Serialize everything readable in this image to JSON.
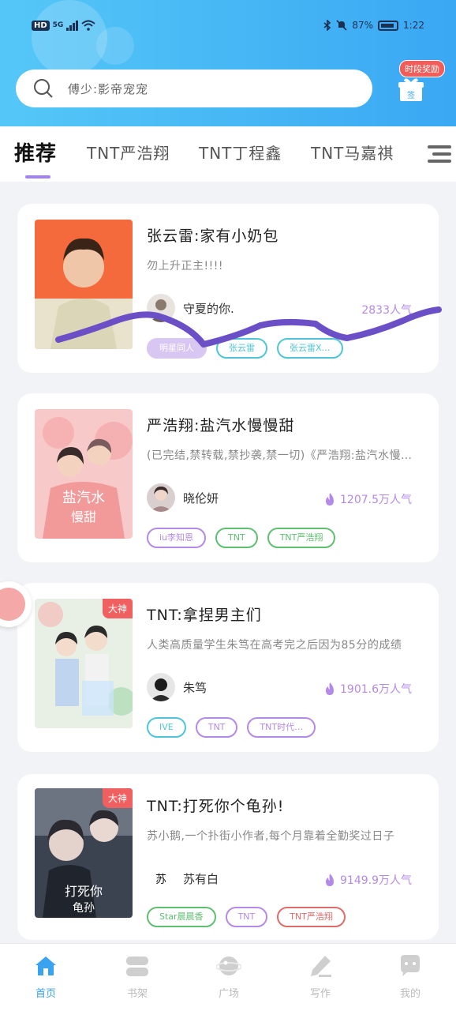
{
  "status_bar": {
    "hd": "HD",
    "signal": "5G",
    "battery": "87%",
    "time": "1:22"
  },
  "search": {
    "placeholder": "傅少:影帝宠宠"
  },
  "gift": {
    "badge": "时段奖励",
    "box_label": "签"
  },
  "tabs": [
    {
      "label": "推荐"
    },
    {
      "label": "TNT严浩翔"
    },
    {
      "label": "TNT丁程鑫"
    },
    {
      "label": "TNT马嘉祺"
    }
  ],
  "cards": [
    {
      "title": "张云雷:家有小奶包",
      "desc": "勿上升正主!!!!",
      "author": "守夏的你.",
      "popularity": "2833人气",
      "cover_tag": "",
      "tags": [
        {
          "label": "明星同人",
          "color": "#b48ae8"
        },
        {
          "label": "张云雷",
          "color": "#4ec6d8"
        },
        {
          "label": "张云雷X…",
          "color": "#4ec6d8"
        }
      ]
    },
    {
      "title": "严浩翔:盐汽水慢慢甜",
      "desc": "(已完结,禁转载,禁抄袭,禁一切)《严浩翔:盐汽水慢慢甜》",
      "author": "晓伦妍",
      "popularity": "1207.5万人气",
      "cover_tag": "",
      "tags": [
        {
          "label": "iu李知恩",
          "color": "#b48ae8"
        },
        {
          "label": "TNT",
          "color": "#5fbf70"
        },
        {
          "label": "TNT严浩翔",
          "color": "#5fbf70"
        }
      ]
    },
    {
      "title": "TNT:拿捏男主们",
      "desc": "人类高质量学生朱笃在高考完之后因为85分的成绩",
      "author": "朱笃",
      "popularity": "1901.6万人气",
      "cover_tag": "大神",
      "tags": [
        {
          "label": "IVE",
          "color": "#4ec6d8"
        },
        {
          "label": "TNT",
          "color": "#b48ae8"
        },
        {
          "label": "TNT时代…",
          "color": "#b48ae8"
        }
      ]
    },
    {
      "title": "TNT:打死你个龟孙!",
      "desc": "苏小鹅,一个扑街小作者,每个月靠着全勤奖过日子",
      "author": "苏有白",
      "popularity": "9149.9万人气",
      "cover_tag": "大神",
      "tags": [
        {
          "label": "Star晨晨香",
          "color": "#5fbf70"
        },
        {
          "label": "TNT",
          "color": "#b48ae8"
        },
        {
          "label": "TNT严浩翔",
          "color": "#e06b6b"
        }
      ]
    }
  ],
  "bottom_nav": [
    {
      "label": "首页",
      "icon": "home-icon",
      "active": true
    },
    {
      "label": "书架",
      "icon": "bookshelf-icon",
      "active": false
    },
    {
      "label": "广场",
      "icon": "planet-icon",
      "active": false
    },
    {
      "label": "写作",
      "icon": "pen-icon",
      "active": false
    },
    {
      "label": "我的",
      "icon": "chat-bubble-icon",
      "active": false
    }
  ],
  "colors": {
    "header_start": "#55c7f7",
    "header_end": "#3aa8f3",
    "accent_purple": "#a184e6",
    "nav_active": "#3aa3f0"
  }
}
